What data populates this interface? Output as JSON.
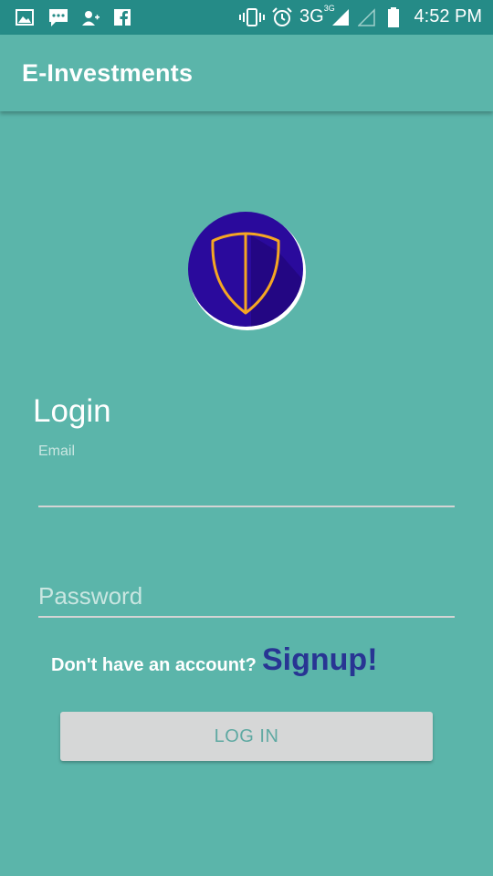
{
  "status_bar": {
    "network": "3G",
    "network_sup": "3G",
    "time": "4:52 PM",
    "left_icons": [
      "gallery-icon",
      "message-icon",
      "add-contact-icon",
      "facebook-icon"
    ],
    "right_icons": [
      "vibrate-icon",
      "alarm-icon",
      "signal-icon",
      "signal-empty-icon",
      "battery-icon"
    ]
  },
  "app_bar": {
    "title": "E-Investments"
  },
  "logo": {
    "icon": "shield-icon",
    "colors": {
      "circle": "#2a0a9c",
      "outline": "#f5a623"
    }
  },
  "form": {
    "heading": "Login",
    "email_label": "Email",
    "email_value": "",
    "password_placeholder": "Password",
    "no_account_text": "Don't have an account?",
    "signup_label": "Signup!",
    "login_button": "LOG IN"
  },
  "colors": {
    "background": "#5bb5aa",
    "status_bar": "#258b87",
    "signup": "#283593",
    "button_bg": "#d6d7d7",
    "button_text": "#5fa9a2"
  }
}
